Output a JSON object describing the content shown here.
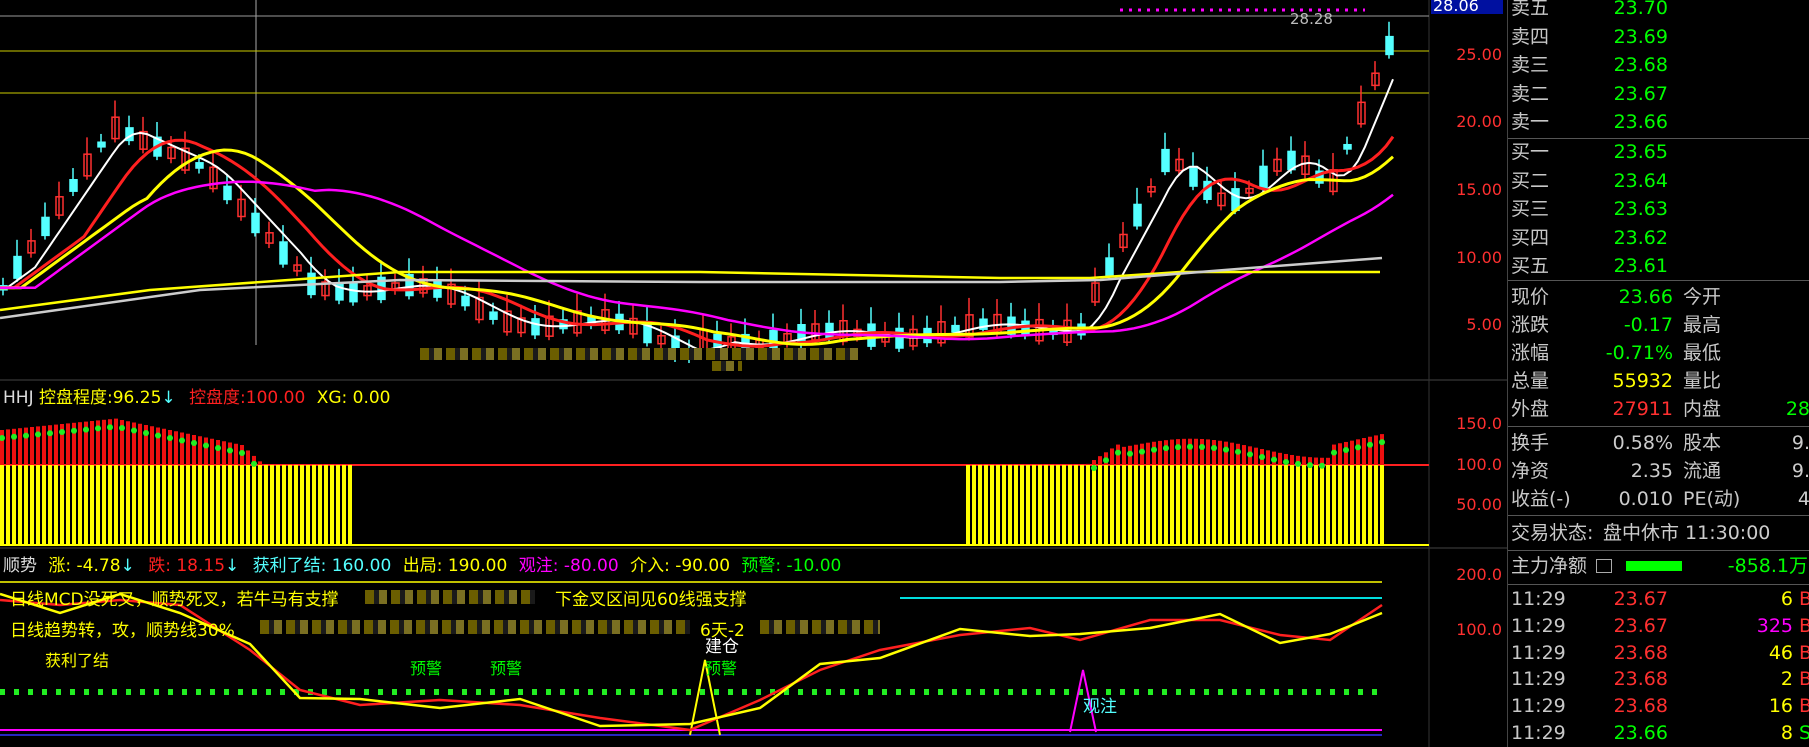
{
  "price_axis": {
    "top_label": "28.06",
    "ticks": [
      "25.00",
      "20.00",
      "15.00",
      "10.00",
      "5.00"
    ],
    "peak_label": "28.28"
  },
  "hhj_axis": {
    "ticks": [
      "150.0",
      "100.0",
      "50.00"
    ]
  },
  "trend_axis": {
    "ticks": [
      "200.0",
      "100.0"
    ]
  },
  "hhj_header": {
    "name": "HHJ",
    "degree_label": "控盘程度:",
    "degree_value": "96.25",
    "arrow": "↓",
    "ctrl_label": "控盘度:",
    "ctrl_value": "100.00",
    "xg_label": "XG:",
    "xg_value": "0.00"
  },
  "trend_header": {
    "name": "顺势",
    "rise_label": "涨:",
    "rise_value": "-4.78",
    "rise_arrow": "↓",
    "fall_label": "跌:",
    "fall_value": "18.15",
    "fall_arrow": "↓",
    "profit": "获利了结: 160.00",
    "exit": "出局: 190.00",
    "watch": "观注: -80.00",
    "enter": "介入: -90.00",
    "warn": "预警: -10.00"
  },
  "annotations": {
    "line1": "日线MCD没死叉，顺势死叉，若牛马有支撑",
    "line1_tail": "下金叉区间见60线强支撑",
    "line2": "日线趋势转，攻，顺势线30%",
    "line2_tail": "6天-2",
    "profit_marker": "获利了结",
    "warn1": "预警",
    "warn2": "预警",
    "build": "建仓",
    "warn3": "预警",
    "watch_marker": "观注"
  },
  "order_book": {
    "sell": [
      {
        "label": "卖五",
        "price": "23.70"
      },
      {
        "label": "卖四",
        "price": "23.69"
      },
      {
        "label": "卖三",
        "price": "23.68"
      },
      {
        "label": "卖二",
        "price": "23.67"
      },
      {
        "label": "卖一",
        "price": "23.66"
      }
    ],
    "buy": [
      {
        "label": "买一",
        "price": "23.65"
      },
      {
        "label": "买二",
        "price": "23.64"
      },
      {
        "label": "买三",
        "price": "23.63"
      },
      {
        "label": "买四",
        "price": "23.62"
      },
      {
        "label": "买五",
        "price": "23.61"
      }
    ]
  },
  "quote": {
    "now_label": "现价",
    "now": "23.66",
    "open_label": "今开",
    "chg_label": "涨跌",
    "chg": "-0.17",
    "high_label": "最高",
    "pct_label": "涨幅",
    "pct": "-0.71%",
    "low_label": "最低",
    "vol_label": "总量",
    "vol": "55932",
    "vr_label": "量比",
    "out_label": "外盘",
    "out": "27911",
    "in_label": "内盘",
    "in_partial": "28",
    "turn_label": "换手",
    "turn": "0.58%",
    "cap_label": "股本",
    "cap_partial": "9.",
    "na_label": "净资",
    "na": "2.35",
    "float_label": "流通",
    "float_partial": "9.",
    "eps_label": "收益(-)",
    "eps": "0.010",
    "pe_label": "PE(动)",
    "pe_partial": "4"
  },
  "status": {
    "label": "交易状态:",
    "value": "盘中休市 11:30:00"
  },
  "main_flow": {
    "label": "主力净额",
    "value": "-858.1万"
  },
  "ticks": [
    {
      "time": "11:29",
      "price": "23.67",
      "vol": "6",
      "side": "B"
    },
    {
      "time": "11:29",
      "price": "23.67",
      "vol": "325",
      "side": "B"
    },
    {
      "time": "11:29",
      "price": "23.68",
      "vol": "46",
      "side": "B"
    },
    {
      "time": "11:29",
      "price": "23.68",
      "vol": "2",
      "side": "B"
    },
    {
      "time": "11:29",
      "price": "23.68",
      "vol": "16",
      "side": "B"
    },
    {
      "time": "11:29",
      "price": "23.66",
      "vol": "8",
      "side": "S"
    }
  ],
  "colors": {
    "up": "#ff3030",
    "down": "#54ffff",
    "yellow": "#ffff00",
    "green": "#00ff00",
    "magenta": "#ff00ff",
    "cyan": "#00ffff",
    "grid": "#9a8a00"
  }
}
